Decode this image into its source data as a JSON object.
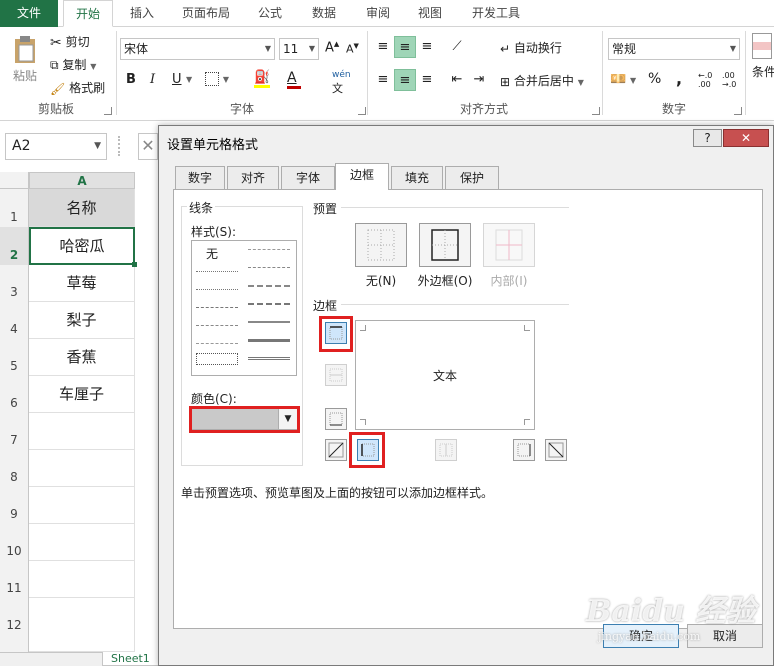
{
  "ribbon": {
    "tabs": [
      "文件",
      "开始",
      "插入",
      "页面布局",
      "公式",
      "数据",
      "审阅",
      "视图",
      "开发工具"
    ],
    "active_tab": "开始",
    "clipboard": {
      "paste": "粘贴",
      "cut": "剪切",
      "copy": "复制",
      "format_painter": "格式刷",
      "group": "剪贴板"
    },
    "font": {
      "name": "宋体",
      "size": "11",
      "bold": "B",
      "italic": "I",
      "underline": "U",
      "group": "字体",
      "wen": "wén"
    },
    "alignment": {
      "wrap": "自动换行",
      "merge": "合并后居中",
      "group": "对齐方式"
    },
    "number": {
      "format": "常规",
      "percent": "%",
      "comma": ",",
      "group": "数字"
    },
    "styles": {
      "conditional": "条件"
    }
  },
  "namebox": {
    "value": "A2"
  },
  "sheet": {
    "column": "A",
    "rows": [
      "1",
      "2",
      "3",
      "4",
      "5",
      "6",
      "7",
      "8",
      "9",
      "10",
      "11",
      "12"
    ],
    "cells": [
      "名称",
      "哈密瓜",
      "草莓",
      "梨子",
      "香蕉",
      "车厘子"
    ],
    "tab_label": "Sheet1"
  },
  "dialog": {
    "title": "设置单元格格式",
    "help": "?",
    "close": "✕",
    "tabs": [
      "数字",
      "对齐",
      "字体",
      "边框",
      "填充",
      "保护"
    ],
    "active_tab": "边框",
    "line_group": "线条",
    "style_label": "样式(S):",
    "style_none": "无",
    "color_label": "颜色(C):",
    "preset_group": "预置",
    "presets": [
      "无(N)",
      "外边框(O)",
      "内部(I)"
    ],
    "border_group": "边框",
    "preview_text": "文本",
    "hint": "单击预置选项、预览草图及上面的按钮可以添加边框样式。",
    "ok": "确定",
    "cancel": "取消"
  },
  "watermark": {
    "text": "Baidu 经验",
    "sub": "jingyan.baidu.com"
  },
  "colors": {
    "excel_green": "#217346",
    "highlight_red": "#e02020",
    "selected_border_button": "#cfe6fb"
  }
}
